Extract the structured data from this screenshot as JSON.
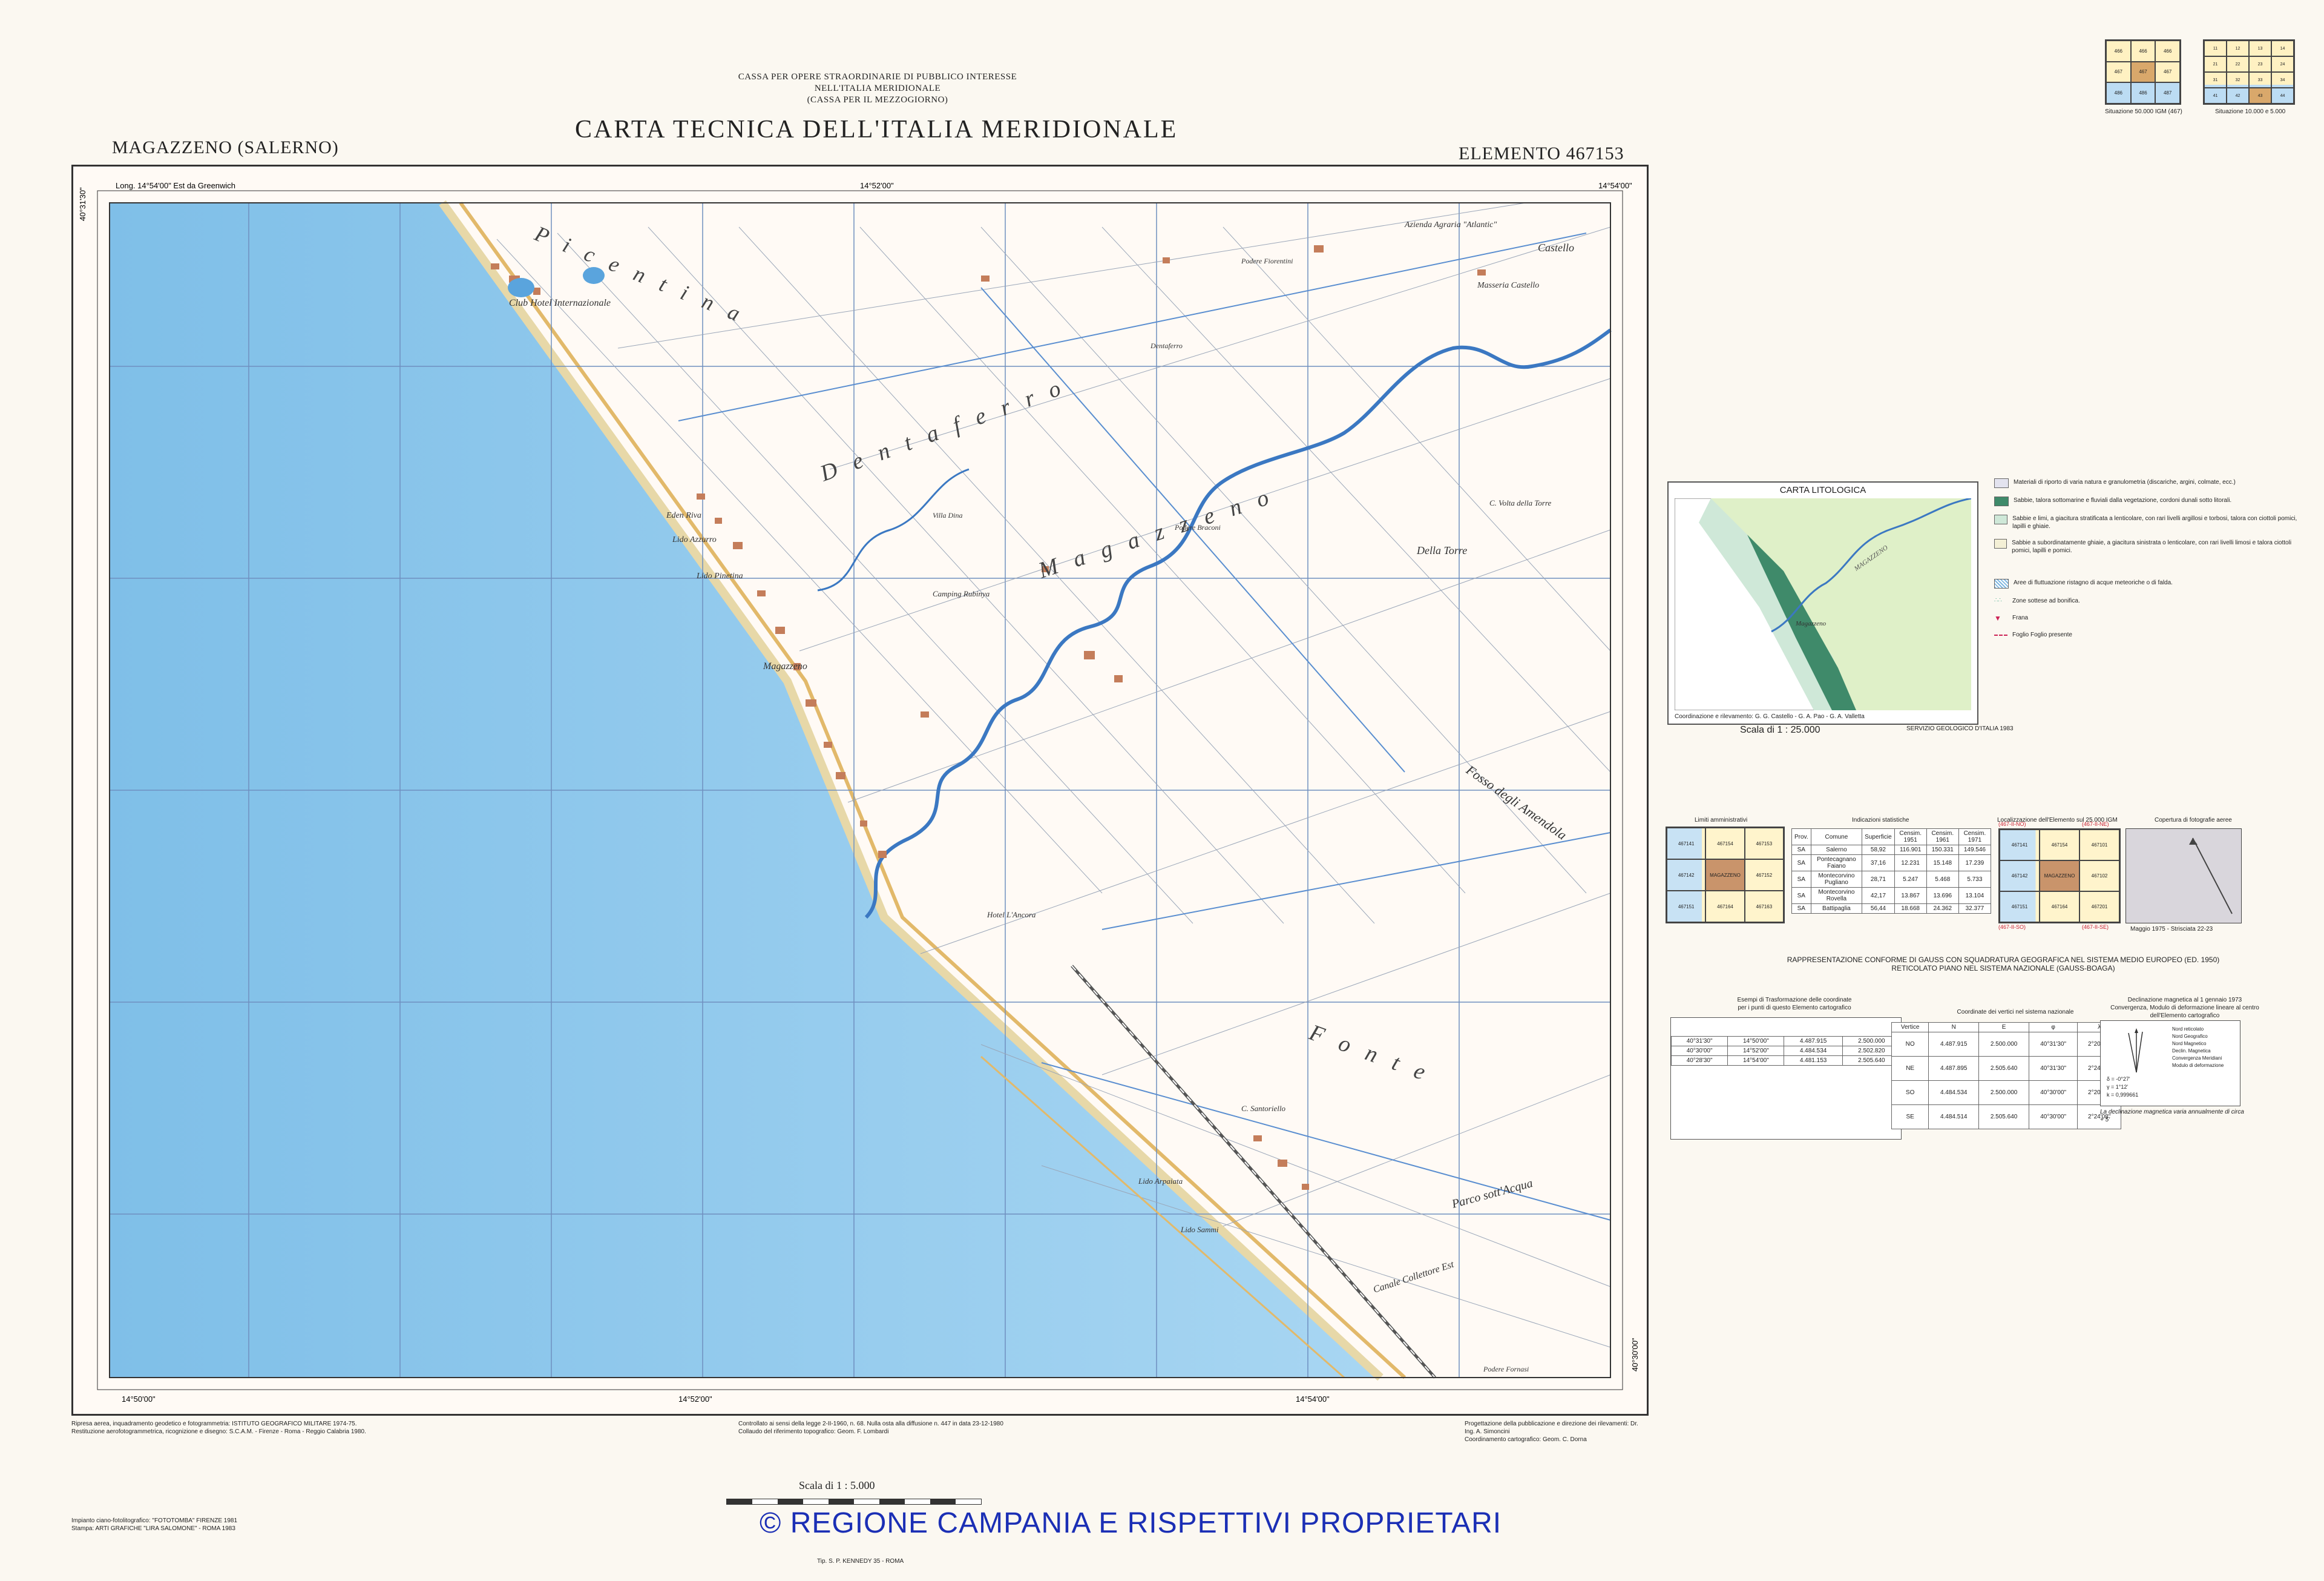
{
  "header": {
    "line1": "CASSA PER OPERE STRAORDINARIE DI PUBBLICO INTERESSE",
    "line2": "NELL'ITALIA MERIDIONALE",
    "line3": "(CASSA PER IL MEZZOGIORNO)",
    "title": "CARTA TECNICA DELL'ITALIA MERIDIONALE",
    "sheet_name": "MAGAZZENO (SALERNO)",
    "element": "ELEMENTO 467153"
  },
  "index_maps": {
    "left_caption": "Situazione 50.000 IGM (467)",
    "right_caption": "Situazione 10.000 e 5.000"
  },
  "map": {
    "coord_top_left": "Long. 14°54'00\" Est da Greenwich",
    "coord_bottom_left": "14°50'00\"",
    "coord_bottom_mid": "14°52'00\"",
    "coord_bottom_right": "14°54'00\"",
    "coord_top_mid": "14°52'00\"",
    "coord_top_right": "14°54'00\"",
    "lat_top": "40°31'30\"",
    "lat_bottom": "40°30'00\"",
    "places": {
      "club": "Club Hotel Internazionale",
      "azienda": "Azienda Agraria \"Atlantic\"",
      "masseria": "Masseria Castello",
      "podere_fiorentini": "Podere Fiorentini",
      "dentaferro_small": "Dentaferro",
      "villa": "Villa Dina",
      "podere_braconi": "Podere Braconi",
      "eden": "Eden Riva",
      "lido_azzurro": "Lido Azzurro",
      "lido_pineta": "Lido Pinetina",
      "camping": "Camping Rubinya",
      "magazzeno_town": "Magazzeno",
      "hotel": "Hotel L'Ancora",
      "vuccola": "C. Volta della Torre",
      "della_torre": "Della Torre",
      "castello": "Castello",
      "c_santoriello": "C. Santoriello",
      "lido_arpaiata": "Lido Arpaiata",
      "lido_sammi": "Lido Sammi",
      "podere_fornasi": "Podere Fornasi",
      "fosso_amendola": "Fosso degli Amendola",
      "parco": "Parco sott'Acqua",
      "canale": "Canale Collettore Est",
      "picentina": "Picentina",
      "dentaferro": "Dentaferro",
      "magazzeno": "Magazzeno",
      "fonte": "Fonte"
    },
    "bottom_notes_left": "Ripresa aerea, inquadramento geodetico e fotogrammetria: ISTITUTO GEOGRAFICO MILITARE 1974-75.",
    "bottom_notes_left2": "Restituzione aerofotogrammetrica, ricognizione e disegno: S.C.A.M. - Firenze - Roma - Reggio Calabria 1980.",
    "bottom_notes_mid": "Controllato ai sensi della legge 2-II-1960, n. 68. Nulla osta alla diffusione n. 447 in data 23-12-1980",
    "bottom_notes_mid2": "Collaudo del riferimento topografico: Geom. F. Lombardi",
    "bottom_notes_right": "Progettazione della pubblicazione e direzione dei rilevamenti: Dr. Ing. A. Simoncini",
    "bottom_notes_right2": "Coordinamento cartografico: Geom. C. Dorna",
    "scale": "Scala di 1 : 5.000",
    "print_left1": "Impianto ciano-fotolitografico: \"FOTOTOMBA\" FIRENZE 1981",
    "print_left2": "Stampa: ARTI GRAFICHE \"LIRA SALOMONE\" - ROMA 1983",
    "print_mid": "Tip. S. P. KENNEDY 35 - ROMA"
  },
  "litho": {
    "title": "CARTA LITOLOGICA",
    "scale": "Scala di 1 : 25.000",
    "legend": [
      "Materiali di riporto di varia natura e granulometria (discariche, argini, colmate, ecc.)",
      "Sabbie, talora sottomarine e fluviali dalla vegetazione, cordoni dunali sotto litorali.",
      "Sabbie e limi, a giacitura stratificata a lenticolare, con rari livelli argillosi e torbosi, talora con ciottoli pomici, lapilli e ghiaie.",
      "Sabbie a subordinatamente ghiaie, a giacitura sinistrata o lenticolare, con rari livelli limosi e talora ciottoli pomici, lapilli e pomici.",
      "Aree di fluttuazione ristagno di acque meteoriche o di falda.",
      "Zone sottese ad bonifica.",
      "Frana",
      "Foglio Foglio presente"
    ],
    "authors": "Coordinazione e rilevamento: G. G. Castello - G. A. Pao - G. A. Valletta",
    "source": "SERVIZIO GEOLOGICO D'ITALIA 1983"
  },
  "boxes": {
    "admin_title": "Limiti amministrativi",
    "stats_title": "Indicazioni statistiche",
    "loc_title": "Localizzazione dell'Elemento sul 25.000 IGM",
    "photo_title": "Copertura di fotografie aeree",
    "photo_note": "Maggio 1975 - Strisciata 22-23",
    "stats_headers": [
      "Prov.",
      "Comune",
      "Superficie",
      "Censim. 1951",
      "Censim. 1961",
      "Censim. 1971"
    ],
    "stats_rows": [
      [
        "SA",
        "Salerno",
        "58,92",
        "116.901",
        "150.331",
        "149.546"
      ],
      [
        "SA",
        "Pontecagnano Faiano",
        "37,16",
        "12.231",
        "15.148",
        "17.239"
      ],
      [
        "SA",
        "Montecorvino Pugliano",
        "28,71",
        "5.247",
        "5.468",
        "5.733"
      ],
      [
        "SA",
        "Montecorvino Rovella",
        "42,17",
        "13.867",
        "13.696",
        "13.104"
      ],
      [
        "SA",
        "Battipaglia",
        "56,44",
        "18.668",
        "24.362",
        "32.377"
      ]
    ],
    "loc_a": "(467-II-SO)",
    "loc_b": "(467-II-SE)",
    "loc_c": "(467-II-NO)",
    "loc_d": "(467-II-NE)",
    "loc_center": "MAGAZZENO",
    "admin_center": "MAGAZZENO"
  },
  "projection": {
    "line1": "RAPPRESENTAZIONE CONFORME DI GAUSS CON SQUADRATURA GEOGRAFICA NEL SISTEMA MEDIO EUROPEO (ED. 1950)",
    "line2": "RETICOLATO PIANO NEL SISTEMA NAZIONALE (GAUSS-BOAGA)"
  },
  "transform": {
    "title": "Esempi di Trasformazione delle coordinate",
    "sub": "per i punti di questo Elemento cartografico",
    "rows": [
      [
        "40°31'30\"",
        "14°50'00\"",
        "4.487.915",
        "2.500.000"
      ],
      [
        "40°30'00\"",
        "14°52'00\"",
        "4.484.534",
        "2.502.820"
      ],
      [
        "40°28'30\"",
        "14°54'00\"",
        "4.481.153",
        "2.505.640"
      ]
    ]
  },
  "vertices": {
    "title": "Coordinate dei vertici nel sistema nazionale",
    "headers": [
      "Vertice",
      "N",
      "E",
      "φ",
      "λ"
    ],
    "rows": [
      [
        "NO",
        "4.487.915",
        "2.500.000",
        "40°31'30\"",
        "2°20'08\""
      ],
      [
        "NE",
        "4.487.895",
        "2.505.640",
        "40°31'30\"",
        "2°24'08\""
      ],
      [
        "SO",
        "4.484.534",
        "2.500.000",
        "40°30'00\"",
        "2°20'08\""
      ],
      [
        "SE",
        "4.484.514",
        "2.505.640",
        "40°30'00\"",
        "2°24'08\""
      ]
    ]
  },
  "decl": {
    "title": "Declinazione magnetica al 1 gennaio 1973",
    "sub": "Convergenza, Modulo di deformazione lineare al centro dell'Elemento cartografico",
    "legend": [
      "Nord reticolato",
      "Nord Geografico",
      "Nord Magnetico",
      "Declin. Magnetica",
      "Convergenza Meridiani",
      "Modulo di deformazione"
    ],
    "vals": [
      "δ = -0°27'",
      "γ = 1°12'",
      "k = 0,999661"
    ],
    "note": "La declinazione magnetica varia annualmente di circa + 5'"
  },
  "copyright": "© REGIONE CAMPANIA E RISPETTIVI PROPRIETARI",
  "colors": {
    "sea": "#8fc6ea",
    "land": "#fffaf5",
    "grid": "#6f8fbf",
    "river": "#3b78c2",
    "road": "#e2b96a",
    "building": "#c47d5a"
  }
}
